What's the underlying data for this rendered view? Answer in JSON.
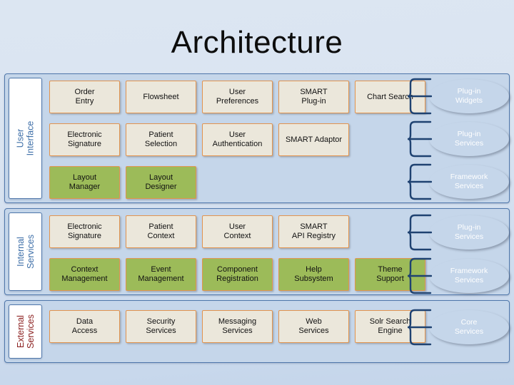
{
  "slide": {
    "title": "Architecture",
    "background_color": "#d3e0f0",
    "accent_blue": "#1f4271",
    "cream_color": "#ebe7db",
    "green_color": "#9cbb59",
    "border_orange": "#e2944f",
    "label_blue": "#3e6fa8",
    "label_red": "#8c2121"
  },
  "sections": [
    {
      "id": "user-interface",
      "label": "User\nInterface",
      "label_line1": "User",
      "label_line2": "Interface",
      "label_color": "#3e6fa8",
      "rows": [
        {
          "style": "cream",
          "boxes": [
            {
              "line1": "Order",
              "line2": "Entry"
            },
            {
              "line1": "Flowsheet",
              "line2": ""
            },
            {
              "line1": "User",
              "line2": "Preferences"
            },
            {
              "line1": "SMART",
              "line2": "Plug-in"
            },
            {
              "line1": "Chart Search",
              "line2": ""
            }
          ]
        },
        {
          "style": "cream",
          "boxes": [
            {
              "line1": "Electronic",
              "line2": "Signature"
            },
            {
              "line1": "Patient",
              "line2": "Selection"
            },
            {
              "line1": "User",
              "line2": "Authentication"
            },
            {
              "line1": "SMART Adaptor",
              "line2": ""
            }
          ]
        },
        {
          "style": "green",
          "boxes": [
            {
              "line1": "Layout",
              "line2": "Manager"
            },
            {
              "line1": "Layout",
              "line2": "Designer"
            }
          ]
        }
      ],
      "callouts": [
        {
          "line1": "Plug-in",
          "line2": "Widgets"
        },
        {
          "line1": "Plug-in",
          "line2": "Services"
        },
        {
          "line1": "Framework",
          "line2": "Services"
        }
      ]
    },
    {
      "id": "internal-services",
      "label_line1": "Internal",
      "label_line2": "Services",
      "label_color": "#3e6fa8",
      "rows": [
        {
          "style": "cream",
          "boxes": [
            {
              "line1": "Electronic",
              "line2": "Signature"
            },
            {
              "line1": "Patient",
              "line2": "Context"
            },
            {
              "line1": "User",
              "line2": "Context"
            },
            {
              "line1": "SMART",
              "line2": "API Registry"
            }
          ]
        },
        {
          "style": "green",
          "boxes": [
            {
              "line1": "Context",
              "line2": "Management"
            },
            {
              "line1": "Event",
              "line2": "Management"
            },
            {
              "line1": "Component",
              "line2": "Registration"
            },
            {
              "line1": "Help",
              "line2": "Subsystem"
            },
            {
              "line1": "Theme",
              "line2": "Support"
            }
          ]
        }
      ],
      "callouts": [
        {
          "line1": "Plug-in",
          "line2": "Services"
        },
        {
          "line1": "Framework",
          "line2": "Services"
        }
      ]
    },
    {
      "id": "external-services",
      "label_line1": "External",
      "label_line2": "Services",
      "label_color": "#8c2121",
      "rows": [
        {
          "style": "cream",
          "boxes": [
            {
              "line1": "Data",
              "line2": "Access"
            },
            {
              "line1": "Security",
              "line2": "Services"
            },
            {
              "line1": "Messaging",
              "line2": "Services"
            },
            {
              "line1": "Web",
              "line2": "Services"
            },
            {
              "line1": "Solr Search",
              "line2": "Engine"
            }
          ]
        }
      ],
      "callouts": [
        {
          "line1": "Core",
          "line2": "Services"
        }
      ]
    }
  ]
}
